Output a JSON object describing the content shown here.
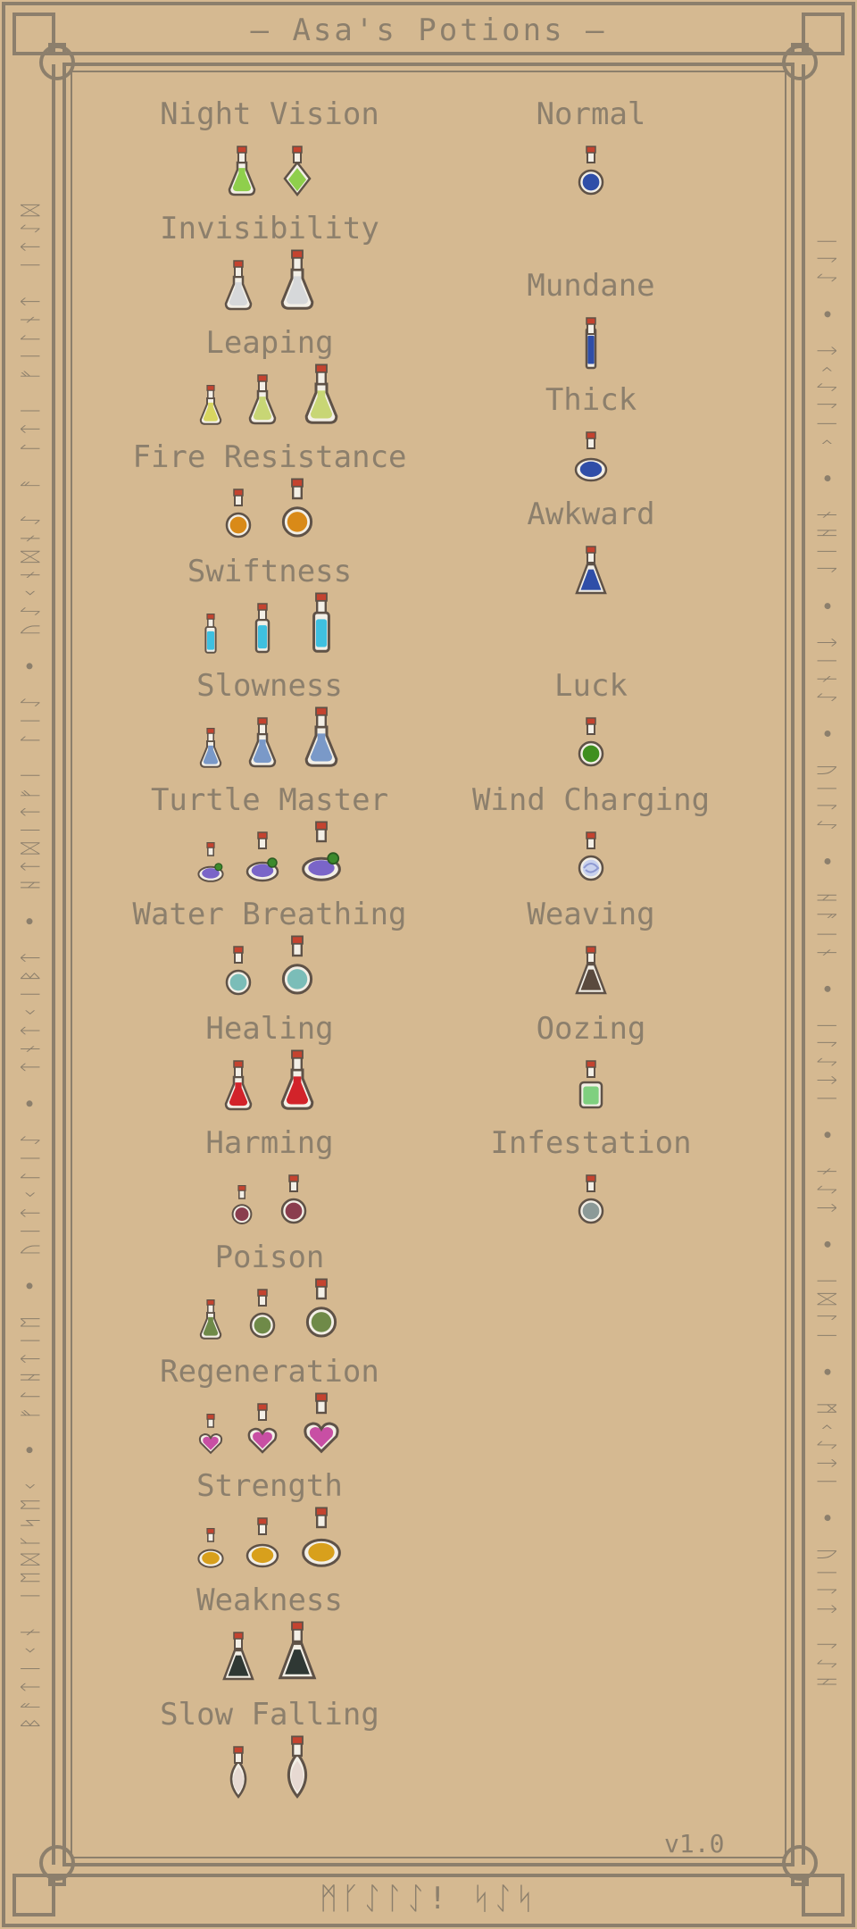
{
  "title": "— Asa's Potions —",
  "footer_runes": "ᛗᚴᛇᛚᛇ! ᛋᛇᛋ",
  "left_runes": "ᛒᚨᛏᛁᚲᚾ ᛁᛖᛞᚴᛋᛖᚲ • ᚠᛚᚺᛏᛁᛖ • ᚢᛁᛏᚲᛚᛁᛇ • ᛏᚾᛏᚲᛁᛒᛏ • ᚺᛏᛞᛁᛏᚠᛁ ᛚᛁᛇ • ᚢᛇᚲᚾᛞᚾᛇ ᚨ ᛚᛏᛁ ᚠᛁᛚᚾᛏ ᛁᛏᛇᛞ",
  "right_runes": "ᛁᛚᛇ • ᛏᚲᛇᛚᛁᚲ • ᚾᚺᛁᛚ • ᛏᛁᚾᛇ • ᚢᛁᛚᛇ • ᚺᚨᛁᚾ • ᛁᛚᛇᛏᛁ • ᚾᛇᛏ • ᛁᛞᛚᛁ • ᛗᚲᛇᛏᛁ • ᚢᛁᛚᛏ ᛚᛇᚺ",
  "version": "v1.0",
  "colors": {
    "background": "#d5b991",
    "frame": "#8c7f6c",
    "cork": "#c4432f"
  },
  "left_column": [
    {
      "name": "Night Vision",
      "potions": [
        {
          "shape": "flask",
          "color": "#8fcf4c"
        },
        {
          "shape": "diamond",
          "color": "#8fcf4c"
        }
      ]
    },
    {
      "name": "Invisibility",
      "potions": [
        {
          "shape": "flask",
          "color": "#d6d8da"
        },
        {
          "shape": "flask-large",
          "color": "#d6d8da"
        }
      ]
    },
    {
      "name": "Leaping",
      "potions": [
        {
          "shape": "flask-small",
          "color": "#d8d660"
        },
        {
          "shape": "flask",
          "color": "#c8d675"
        },
        {
          "shape": "flask-large",
          "color": "#c8d675"
        }
      ]
    },
    {
      "name": "Fire Resistance",
      "potions": [
        {
          "shape": "round",
          "color": "#d98a18"
        },
        {
          "shape": "round-large",
          "color": "#d98a18"
        }
      ]
    },
    {
      "name": "Swiftness",
      "potions": [
        {
          "shape": "tube-small",
          "color": "#3fc0e0"
        },
        {
          "shape": "tube",
          "color": "#3fc0e0"
        },
        {
          "shape": "tube-large",
          "color": "#3fc0e0"
        }
      ]
    },
    {
      "name": "Slowness",
      "potions": [
        {
          "shape": "flask-small",
          "color": "#7a99c8"
        },
        {
          "shape": "flask",
          "color": "#7a99c8"
        },
        {
          "shape": "flask-large",
          "color": "#7a99c8"
        }
      ]
    },
    {
      "name": "Turtle Master",
      "potions": [
        {
          "shape": "turtle-small",
          "color": "#7a65c8"
        },
        {
          "shape": "turtle",
          "color": "#7a65c8"
        },
        {
          "shape": "turtle-large",
          "color": "#7a65c8"
        }
      ]
    },
    {
      "name": "Water Breathing",
      "potions": [
        {
          "shape": "round",
          "color": "#7bbdb8"
        },
        {
          "shape": "round-large",
          "color": "#7bbdb8"
        }
      ]
    },
    {
      "name": "Healing",
      "potions": [
        {
          "shape": "flask",
          "color": "#d2232a"
        },
        {
          "shape": "flask-large",
          "color": "#d2232a"
        }
      ]
    },
    {
      "name": "Harming",
      "potions": [
        {
          "shape": "round-small",
          "color": "#8a3d4e"
        },
        {
          "shape": "round",
          "color": "#8a3d4e"
        }
      ]
    },
    {
      "name": "Poison",
      "potions": [
        {
          "shape": "flask-small",
          "color": "#6f8a48"
        },
        {
          "shape": "round",
          "color": "#6f8a48"
        },
        {
          "shape": "round-large",
          "color": "#6f8a48"
        }
      ]
    },
    {
      "name": "Regeneration",
      "potions": [
        {
          "shape": "heart-small",
          "color": "#c84fa4"
        },
        {
          "shape": "heart",
          "color": "#c84fa4"
        },
        {
          "shape": "heart-large",
          "color": "#c84fa4"
        }
      ]
    },
    {
      "name": "Strength",
      "potions": [
        {
          "shape": "wide-small",
          "color": "#d8a01c"
        },
        {
          "shape": "wide",
          "color": "#d8a01c"
        },
        {
          "shape": "wide-large",
          "color": "#d8a01c"
        }
      ]
    },
    {
      "name": "Weakness",
      "potions": [
        {
          "shape": "cone",
          "color": "#2f3834"
        },
        {
          "shape": "cone-large",
          "color": "#2f3834"
        }
      ]
    },
    {
      "name": "Slow Falling",
      "potions": [
        {
          "shape": "drop",
          "color": "#e7d9d2"
        },
        {
          "shape": "drop-large",
          "color": "#e7d9d2"
        }
      ]
    }
  ],
  "right_column": [
    {
      "name": "Normal",
      "potions": [
        {
          "shape": "round",
          "color": "#2f4ea8"
        }
      ]
    },
    {
      "name": "Mundane",
      "potions": [
        {
          "shape": "tube-thin",
          "color": "#2f4ea8"
        }
      ]
    },
    {
      "name": "Thick",
      "potions": [
        {
          "shape": "wide",
          "color": "#2f4ea8"
        }
      ]
    },
    {
      "name": "Awkward",
      "potions": [
        {
          "shape": "cone",
          "color": "#2f4ea8"
        }
      ]
    },
    {
      "name": "Luck",
      "potions": [
        {
          "shape": "round",
          "color": "#3f8f1f"
        }
      ]
    },
    {
      "name": "Wind Charging",
      "potions": [
        {
          "shape": "swirl",
          "color": "#c9d2ee"
        }
      ]
    },
    {
      "name": "Weaving",
      "potions": [
        {
          "shape": "cone",
          "color": "#5a4a3e"
        }
      ]
    },
    {
      "name": "Oozing",
      "potions": [
        {
          "shape": "square",
          "color": "#7fd07f"
        }
      ]
    },
    {
      "name": "Infestation",
      "potions": [
        {
          "shape": "round",
          "color": "#8c9a98"
        }
      ]
    }
  ]
}
